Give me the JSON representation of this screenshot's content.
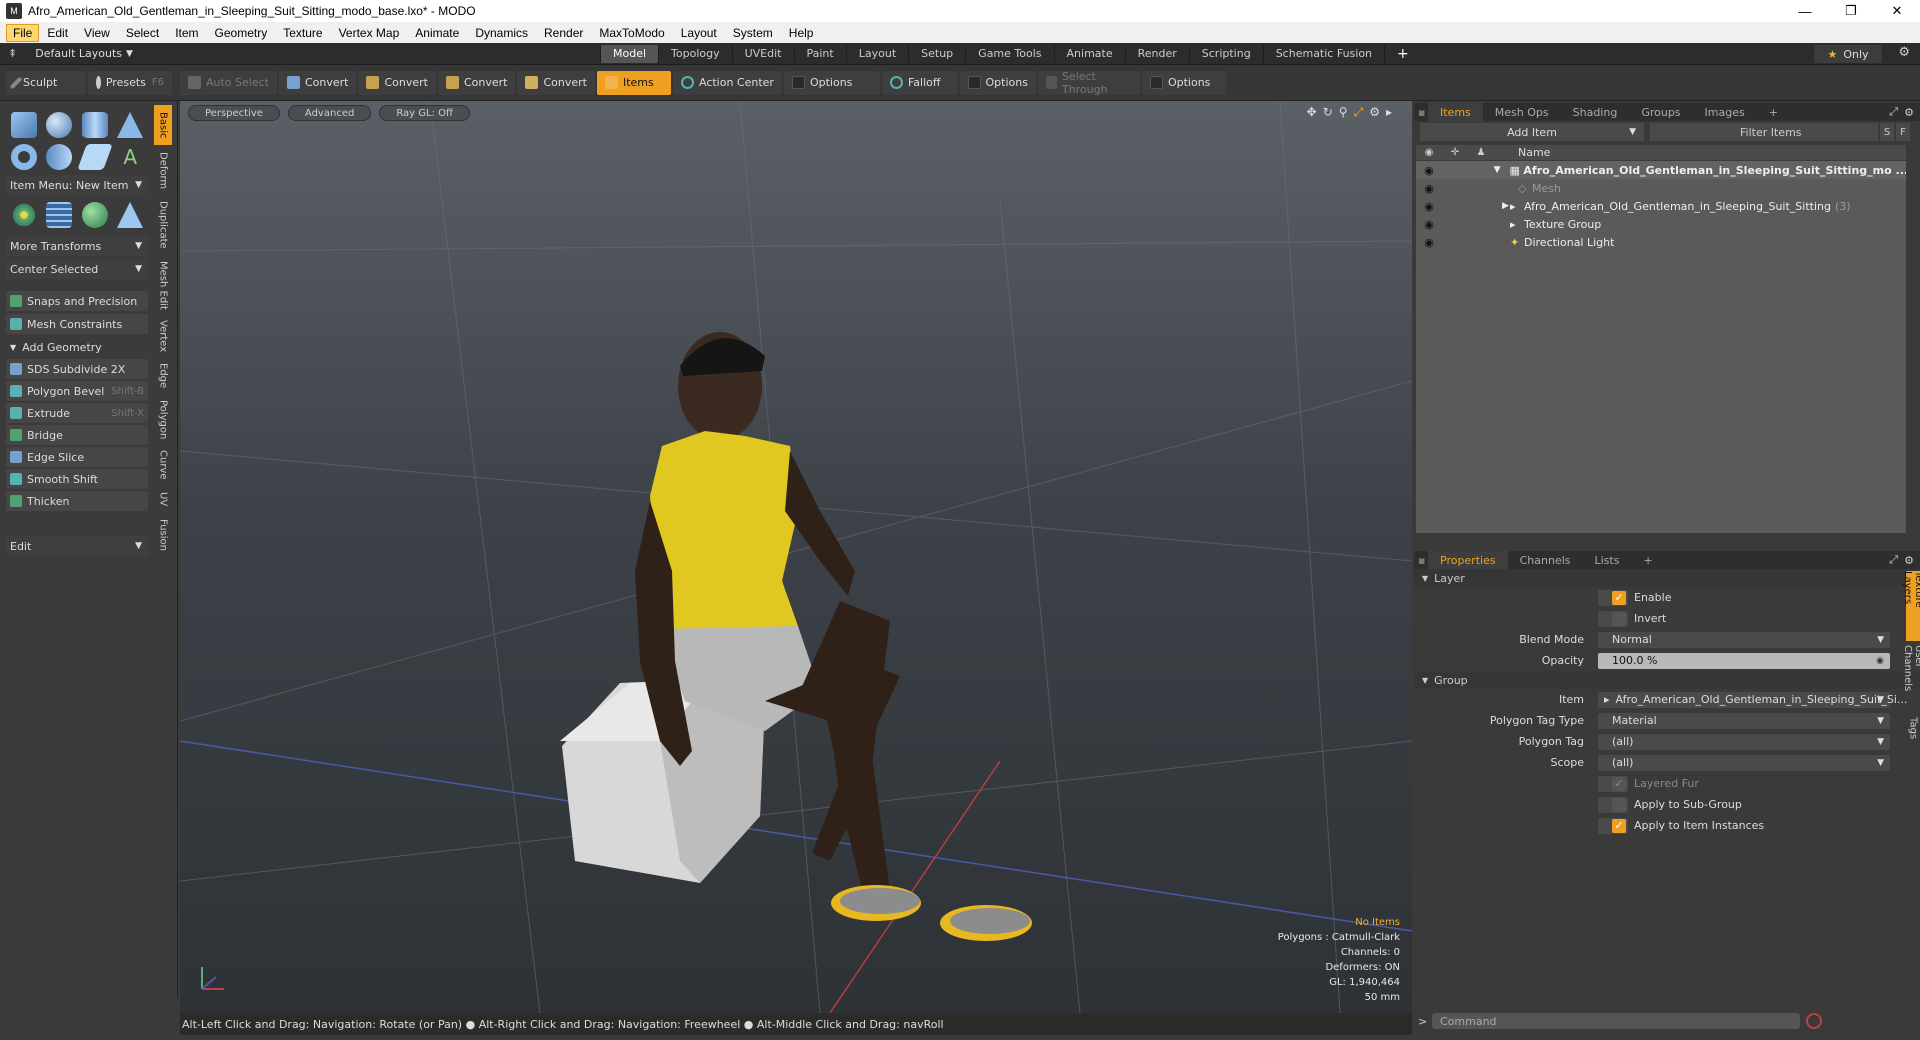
{
  "window": {
    "title": "Afro_American_Old_Gentleman_in_Sleeping_Suit_Sitting_modo_base.lxo* - MODO",
    "minimize": "—",
    "maximize": "❐",
    "close": "✕"
  },
  "menu": [
    "File",
    "Edit",
    "View",
    "Select",
    "Item",
    "Geometry",
    "Texture",
    "Vertex Map",
    "Animate",
    "Dynamics",
    "Render",
    "MaxToModo",
    "Layout",
    "System",
    "Help"
  ],
  "layout_bar": {
    "default_layouts": "Default Layouts",
    "tabs": [
      "Model",
      "Topology",
      "UVEdit",
      "Paint",
      "Layout",
      "Setup",
      "Game Tools",
      "Animate",
      "Render",
      "Scripting",
      "Schematic Fusion"
    ],
    "selected_tab": "Model",
    "add": "+",
    "only_label": "Only"
  },
  "toolbar": {
    "sculpt": "Sculpt",
    "presets": "Presets",
    "presets_key": "F6",
    "auto_select": "Auto Select",
    "convert1": "Convert",
    "convert2": "Convert",
    "convert3": "Convert",
    "convert4": "Convert",
    "items": "Items",
    "action_center": "Action Center",
    "options1": "Options",
    "falloff": "Falloff",
    "options2": "Options",
    "select_through": "Select Through",
    "options3": "Options"
  },
  "left_panel": {
    "item_menu": "Item Menu: New Item",
    "more_transforms": "More Transforms",
    "center_selected": "Center Selected",
    "snaps": "Snaps and Precision",
    "mesh_constraints": "Mesh Constraints",
    "add_geometry": "Add Geometry",
    "tools": [
      {
        "label": "SDS Subdivide 2X",
        "shortcut": "",
        "color": "#7aa0d0"
      },
      {
        "label": "Polygon Bevel",
        "shortcut": "Shift-B",
        "color": "#5bb0b0"
      },
      {
        "label": "Extrude",
        "shortcut": "Shift-X",
        "color": "#5bb0b0"
      },
      {
        "label": "Bridge",
        "shortcut": "",
        "color": "#50a070"
      },
      {
        "label": "Edge Slice",
        "shortcut": "",
        "color": "#7aa0d0"
      },
      {
        "label": "Smooth Shift",
        "shortcut": "",
        "color": "#5bb0b0"
      },
      {
        "label": "Thicken",
        "shortcut": "",
        "color": "#50a070"
      }
    ],
    "edit": "Edit",
    "vertical_tabs": [
      "Basic",
      "Deform",
      "Duplicate",
      "Mesh Edit",
      "Vertex",
      "Edge",
      "Polygon",
      "Curve",
      "UV",
      "Fusion"
    ]
  },
  "viewport": {
    "tabs": [
      "Perspective",
      "Advanced",
      "Ray GL: Off"
    ],
    "info": {
      "no_items": "No Items",
      "polygons": "Polygons : Catmull-Clark",
      "channels": "Channels: 0",
      "deformers": "Deformers: ON",
      "gl": "GL: 1,940,464",
      "size": "50 mm"
    }
  },
  "status": "Alt-Left Click and Drag: Navigation: Rotate (or Pan) ● Alt-Right Click and Drag: Navigation: Freewheel ● Alt-Middle Click and Drag: navRoll",
  "right_panel": {
    "top_tabs": [
      "Items",
      "Mesh Ops",
      "Shading",
      "Groups",
      "Images"
    ],
    "add_item": "Add Item",
    "filter_items": "Filter Items",
    "s_btn": "S",
    "f_btn": "F",
    "list_header": "Name",
    "items": [
      {
        "name": "Afro_American_Old_Gentleman_in_Sleeping_Suit_Sitting_mo ...",
        "count": ""
      },
      {
        "name": "Mesh",
        "count": ""
      },
      {
        "name": "Afro_American_Old_Gentleman_in_Sleeping_Suit_Sitting",
        "count": "(3)"
      },
      {
        "name": "Texture Group",
        "count": ""
      },
      {
        "name": "Directional Light",
        "count": ""
      }
    ],
    "prop_tabs": [
      "Properties",
      "Channels",
      "Lists"
    ],
    "layer_section": "Layer",
    "enable": "Enable",
    "invert": "Invert",
    "blend_mode_label": "Blend Mode",
    "blend_mode": "Normal",
    "opacity_label": "Opacity",
    "opacity": "100.0 %",
    "group_section": "Group",
    "item_label": "Item",
    "item_value": "Afro_American_Old_Gentleman_in_Sleeping_Suit_Si...",
    "ptt_label": "Polygon Tag Type",
    "ptt_value": "Material",
    "pt_label": "Polygon Tag",
    "pt_value": "(all)",
    "scope_label": "Scope",
    "scope_value": "(all)",
    "layered_fur": "Layered Fur",
    "apply_sub": "Apply to Sub-Group",
    "apply_inst": "Apply to Item Instances",
    "side_tabs": [
      "Texture Layers",
      "User Channels",
      "Tags"
    ],
    "command_placeholder": "Command"
  }
}
